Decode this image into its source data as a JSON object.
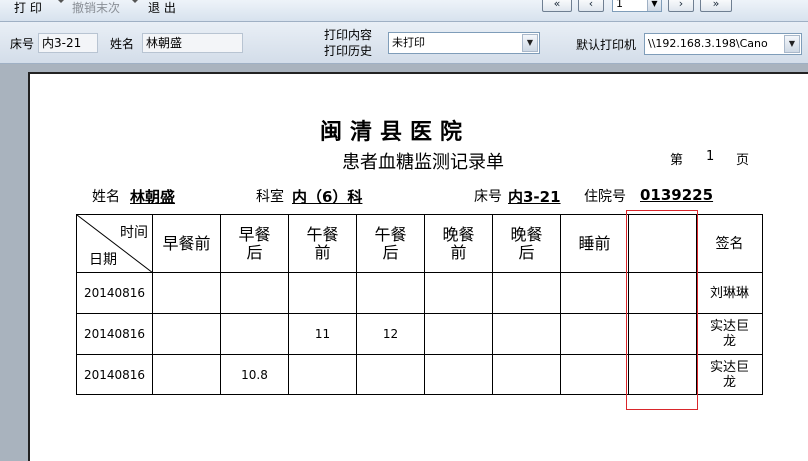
{
  "toolbar": {
    "print_label": "打 印",
    "undo_label": "撤销末次",
    "exit_label": "退 出",
    "first_label": "«",
    "prev_label": "‹",
    "page_value": "1",
    "next_label": "›",
    "last_label": "»"
  },
  "info": {
    "bed_label": "床号",
    "bed_value": "内3-21",
    "name_label": "姓名",
    "name_value": "林朝盛",
    "print_content_label": "打印内容",
    "print_history_label": "打印历史",
    "print_content_value": "未打印",
    "default_printer_label": "默认打印机",
    "default_printer_value": "\\\\192.168.3.198\\Cano"
  },
  "document": {
    "hospital": "闽清县医院",
    "form_title": "患者血糖监测记录单",
    "page_prefix": "第",
    "page_number": "1",
    "page_suffix": "页",
    "patient_name_label": "姓名",
    "patient_name": "林朝盛",
    "dept_label": "科室",
    "dept": "内（6）科",
    "bed_label": "床号",
    "bed": "内3-21",
    "admission_label": "住院号",
    "admission_no": "0139225"
  },
  "table": {
    "corner_top": "时间",
    "corner_bottom": "日期",
    "columns": [
      "早餐前",
      "早餐\n后",
      "午餐\n前",
      "午餐\n后",
      "晚餐\n前",
      "晚餐\n后",
      "睡前",
      "",
      "签名"
    ],
    "rows": [
      {
        "date": "20140816",
        "cells": [
          "",
          "",
          "",
          "",
          "",
          "",
          "",
          ""
        ],
        "sign": "刘琳琳"
      },
      {
        "date": "20140816",
        "cells": [
          "",
          "",
          "11",
          "12",
          "",
          "",
          "",
          ""
        ],
        "sign": "实达巨\n龙"
      },
      {
        "date": "20140816",
        "cells": [
          "",
          "10.8",
          "",
          "",
          "",
          "",
          "",
          ""
        ],
        "sign": "实达巨\n龙"
      }
    ]
  },
  "colors": {
    "highlight": "#d9262b"
  }
}
